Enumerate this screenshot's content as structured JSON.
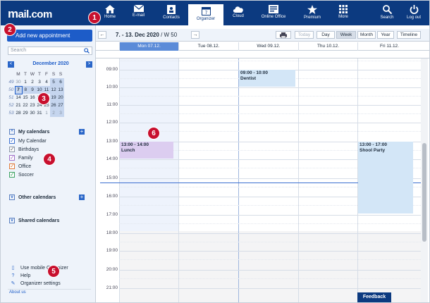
{
  "brand": {
    "logo_prefix": "m",
    "logo_rest": "ail.com"
  },
  "nav": [
    {
      "label": "Home",
      "icon": "home-icon"
    },
    {
      "label": "E-mail",
      "icon": "mail-icon"
    },
    {
      "label": "Contacts",
      "icon": "contacts-icon"
    },
    {
      "label": "Organizer",
      "icon": "calendar-icon",
      "active": true
    },
    {
      "label": "Cloud",
      "icon": "cloud-icon"
    },
    {
      "label": "Online Office",
      "icon": "office-icon"
    },
    {
      "label": "Premium",
      "icon": "star-icon"
    },
    {
      "label": "More",
      "icon": "grid-icon"
    },
    {
      "label": "Search",
      "icon": "search-icon"
    },
    {
      "label": "Log out",
      "icon": "power-icon"
    }
  ],
  "calendar_icon_day": "7",
  "sidebar": {
    "add_button": "Add new appointment",
    "search_placeholder": "Search",
    "minical": {
      "title": "December 2020",
      "prev": "<",
      "next": ">",
      "weekdays": [
        "M",
        "T",
        "W",
        "T",
        "F",
        "S",
        "S"
      ],
      "weeks": [
        {
          "wk": "49",
          "days": [
            "30",
            "1",
            "2",
            "3",
            "4",
            "5",
            "6"
          ]
        },
        {
          "wk": "50",
          "days": [
            "7",
            "8",
            "9",
            "10",
            "11",
            "12",
            "13"
          ]
        },
        {
          "wk": "51",
          "days": [
            "14",
            "15",
            "16",
            "17",
            "18",
            "19",
            "20"
          ]
        },
        {
          "wk": "52",
          "days": [
            "21",
            "22",
            "23",
            "24",
            "25",
            "26",
            "27"
          ]
        },
        {
          "wk": "53",
          "days": [
            "28",
            "29",
            "30",
            "31",
            "1",
            "2",
            "3"
          ]
        }
      ]
    },
    "my_calendars_title": "My calendars",
    "calendars": [
      {
        "label": "My Calendar",
        "color": "#3a6fd0"
      },
      {
        "label": "Birthdays",
        "color": "#ffffff"
      },
      {
        "label": "Family",
        "color": "#a070c8"
      },
      {
        "label": "Office",
        "color": "#e07a3a"
      },
      {
        "label": "Soccer",
        "color": "#3aa060"
      }
    ],
    "other_calendars_title": "Other calendars",
    "shared_calendars_title": "Shared calendars",
    "links": [
      {
        "label": "Use mobile Organizer",
        "icon": "mobile-icon"
      },
      {
        "label": "Help",
        "icon": "help-icon"
      },
      {
        "label": "Organizer settings",
        "icon": "wrench-icon"
      }
    ],
    "about": "About us"
  },
  "toolbar": {
    "range": "7. - 13. Dec 2020",
    "week": "/ W 50",
    "buttons": {
      "today": "Today",
      "day": "Day",
      "week": "Week",
      "month": "Month",
      "year": "Year",
      "timeline": "Timeline"
    }
  },
  "days": [
    {
      "label": "Mon 07.12."
    },
    {
      "label": "Tue 08.12."
    },
    {
      "label": "Wed 09.12."
    },
    {
      "label": "Thu 10.12."
    },
    {
      "label": "Fri 11.12."
    }
  ],
  "hours": [
    "09:00",
    "10:00",
    "11:00",
    "12:00",
    "13:00",
    "14:00",
    "15:00",
    "16:00",
    "17:00",
    "18:00",
    "19:00",
    "20:00",
    "21:00"
  ],
  "events": [
    {
      "time": "09:00 - 10:00",
      "title": "Dentist",
      "color": "#d3e6f7"
    },
    {
      "time": "13:00 - 14:00",
      "title": "Lunch",
      "color": "#dccdf0"
    },
    {
      "time": "13:00 - 17:00",
      "title": "Shool Party",
      "color": "#d3e6f7"
    }
  ],
  "feedback": "Feedback",
  "markers": [
    "1",
    "2",
    "3",
    "4",
    "5",
    "6"
  ]
}
